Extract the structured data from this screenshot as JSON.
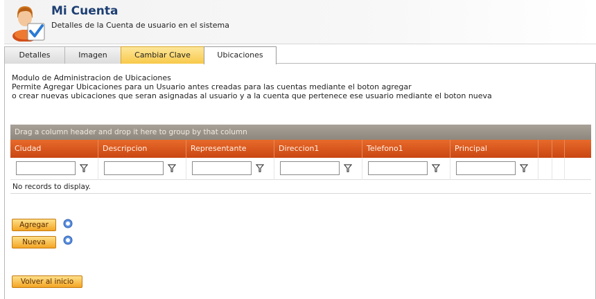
{
  "header": {
    "title": "Mi Cuenta",
    "subtitle": "Detalles de la Cuenta de usuario en el sistema"
  },
  "tabs": [
    {
      "label": "Detalles",
      "state": "normal"
    },
    {
      "label": "Imagen",
      "state": "normal"
    },
    {
      "label": "Cambiar Clave",
      "state": "highlight"
    },
    {
      "label": "Ubicaciones",
      "state": "active"
    }
  ],
  "description": [
    "Modulo de Administracion de Ubicaciones",
    "Permite Agregar Ubicaciones para un Usuario antes creadas para las cuentas mediante el boton agregar",
    "o crear nuevas ubicaciones que seran asignadas al usuario y a la cuenta que pertenece ese usuario mediante el boton nueva"
  ],
  "grid": {
    "group_hint": "Drag a column header and drop it here to group by that column",
    "columns": [
      "Ciudad",
      "Descripcion",
      "Representante",
      "Direccion1",
      "Telefono1",
      "Principal"
    ],
    "filter_values": [
      "",
      "",
      "",
      "",
      "",
      ""
    ],
    "empty_text": "No records to display."
  },
  "buttons": {
    "agregar": "Agregar",
    "nueva": "Nueva",
    "volver": "Volver al inicio"
  },
  "colors": {
    "header_title": "#1d3f73",
    "grid_header": "#d5531a",
    "group_bar": "#9a9389",
    "button": "#f6b23a"
  }
}
